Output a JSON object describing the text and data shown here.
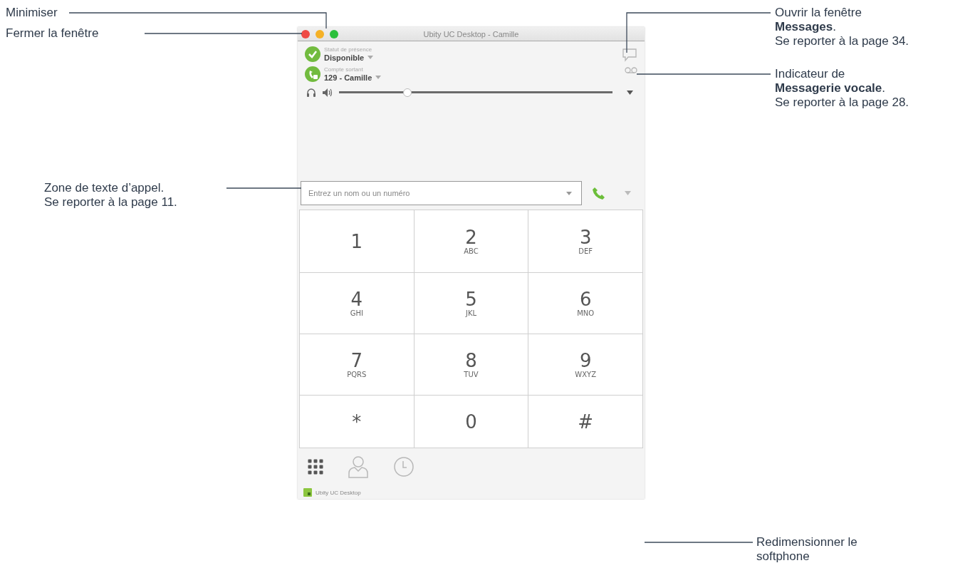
{
  "callouts": [
    {
      "lines": [
        "Minimiser"
      ]
    },
    {
      "lines": [
        "Fermer la fenêtre"
      ]
    },
    {
      "lines": [
        "Ouvrir la fenêtre",
        "**Messages**.",
        "Se reporter à la page 34."
      ]
    },
    {
      "lines": [
        "Indicateur de",
        "**Messagerie vocale**.",
        "Se reporter à la page 28."
      ]
    },
    {
      "lines": [
        "Zone de texte d’appel.",
        "Se reporter à la page 11."
      ]
    },
    {
      "lines": [
        "Redimensionner le",
        "softphone"
      ]
    }
  ],
  "window": {
    "title": "Ubity UC Desktop - Camille"
  },
  "presence": {
    "label": "Statut de présence",
    "value": "Disponible"
  },
  "account": {
    "label": "Compte sortant",
    "value": "129 - Camille"
  },
  "volume": {
    "level": 0.25
  },
  "dial_field": {
    "placeholder": "Entrez un nom ou un numéro"
  },
  "keypad": [
    {
      "digit": "1"
    },
    {
      "digit": "2",
      "letters": "ABC"
    },
    {
      "digit": "3",
      "letters": "DEF"
    },
    {
      "digit": "4",
      "letters": "GHI"
    },
    {
      "digit": "5",
      "letters": "JKL"
    },
    {
      "digit": "6",
      "letters": "MNO"
    },
    {
      "digit": "7",
      "letters": "PQRS"
    },
    {
      "digit": "8",
      "letters": "TUV"
    },
    {
      "digit": "9",
      "letters": "WXYZ"
    },
    {
      "digit": "*"
    },
    {
      "digit": "0"
    },
    {
      "digit": "#"
    }
  ],
  "bottom_tabs": [
    {
      "kind": "keypad",
      "selected": true
    },
    {
      "kind": "contacts",
      "selected": false
    },
    {
      "kind": "history",
      "selected": false
    }
  ],
  "brand": {
    "label": "Ubity UC Desktop"
  }
}
